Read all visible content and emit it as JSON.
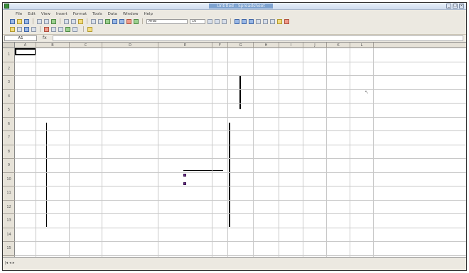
{
  "window": {
    "title": "Untitled - Spreadsheet"
  },
  "menu": {
    "items": [
      "File",
      "Edit",
      "View",
      "Insert",
      "Format",
      "Tools",
      "Data",
      "Window",
      "Help"
    ],
    "right_text": ""
  },
  "toolbar": {
    "font_name": "Arial",
    "font_size": "10"
  },
  "formula": {
    "cell_ref": "A1",
    "fx": "fx",
    "content": ""
  },
  "columns": [
    "A",
    "B",
    "C",
    "D",
    "E",
    "F",
    "G",
    "H",
    "I",
    "J",
    "K",
    "L"
  ],
  "rows": [
    "1",
    "2",
    "3",
    "4",
    "5",
    "6",
    "7",
    "8",
    "9",
    "10",
    "11",
    "12",
    "13",
    "14",
    "15"
  ],
  "sheet": {
    "header_left": "",
    "header_right": "",
    "values": [
      "",
      "",
      "",
      ""
    ],
    "labels": [
      "",
      "",
      "",
      ""
    ]
  },
  "chart": {
    "title": "",
    "legend": [
      "",
      ""
    ]
  },
  "status": {
    "sheet_tab": "",
    "left": "",
    "mid": "",
    "right": ""
  },
  "colors": {
    "accent_green": "#0a8a1e",
    "legend_purple": "#6a2a86"
  }
}
